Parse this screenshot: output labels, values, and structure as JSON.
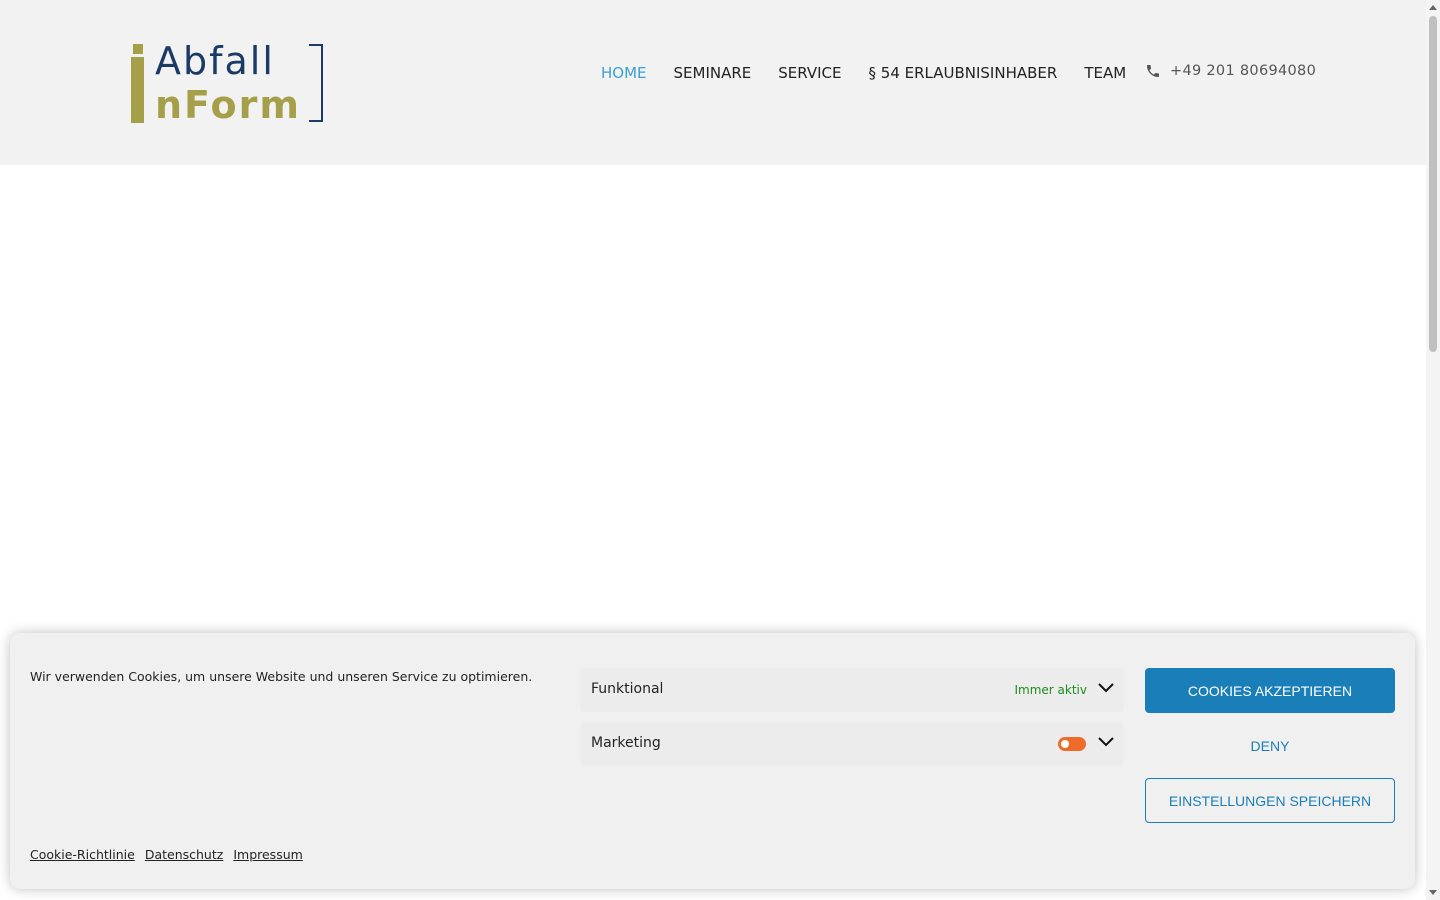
{
  "header": {
    "logo": {
      "line1": "Abfall",
      "line2": "nForm",
      "colors": {
        "blue": "#1c3a66",
        "olive": "#a59f4a"
      }
    },
    "nav": [
      {
        "label": "HOME",
        "active": true
      },
      {
        "label": "SEMINARE",
        "active": false
      },
      {
        "label": "SERVICE",
        "active": false
      },
      {
        "label": "§ 54 ERLAUBNISINHABER",
        "active": false
      },
      {
        "label": "TEAM",
        "active": false
      }
    ],
    "phone": {
      "icon": "phone-icon",
      "number": "+49 201 80694080"
    }
  },
  "cookie_banner": {
    "message": "Wir verwenden Cookies, um unsere Website und unseren Service zu optimieren.",
    "categories": [
      {
        "label": "Funktional",
        "status": "Immer aktiv"
      },
      {
        "label": "Marketing",
        "toggle_on": false
      }
    ],
    "buttons": {
      "accept": "COOKIES AKZEPTIEREN",
      "deny": "DENY",
      "save": "EINSTELLUNGEN SPEICHERN"
    },
    "links": [
      "Cookie-Richtlinie",
      "Datenschutz",
      "Impressum"
    ],
    "colors": {
      "primary": "#1a7fb8",
      "toggle": "#ef6b2a",
      "active_status": "#1e8c1e"
    }
  }
}
